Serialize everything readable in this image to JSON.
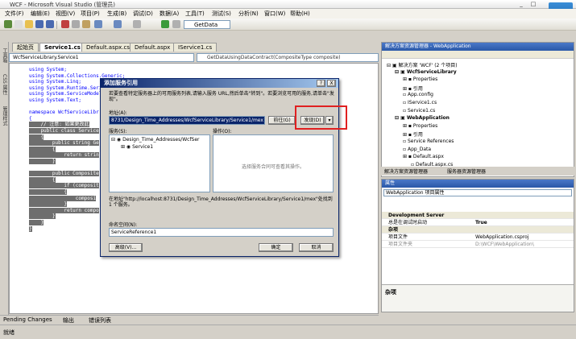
{
  "window": {
    "title": "WCF - Microsoft Visual Studio (管理员)",
    "min": "_",
    "max": "□",
    "close": "X"
  },
  "menu": [
    "文件(F)",
    "编辑(E)",
    "视图(V)",
    "项目(P)",
    "生成(B)",
    "调试(D)",
    "数据(A)",
    "工具(T)",
    "测试(S)",
    "分析(N)",
    "窗口(W)",
    "帮助(H)"
  ],
  "toolbar": {
    "combo_value": "GetData"
  },
  "side_tabs": [
    "工具箱",
    "CSS 属性",
    "管理样式"
  ],
  "doc_tabs": [
    "起始页",
    "Service1.cs",
    "Default.aspx.cs",
    "Default.aspx",
    "IService1.cs"
  ],
  "class_combo": "WcfServiceLibrary.Service1",
  "method_combo": "GetDataUsingDataContract(CompositeType composite)",
  "code_lines": [
    "using System;",
    "using System.Collections.Generic;",
    "using System.Linq;",
    "using System.Runtime.Seri",
    "using System.ServiceModel",
    "using System.Text;",
    "",
    "namespace WcfServiceLibr",
    "{",
    "    // 注意: 如果更改此",
    "    public class Service",
    "    {",
    "        public string Ge",
    "        {",
    "            return strin",
    "        }",
    "",
    "        public Composite",
    "        {",
    "            if (composit",
    "            {",
    "                composi",
    "            }",
    "            return compo",
    "        }",
    "    }",
    "}"
  ],
  "bottom_tabs": [
    "Pending Changes",
    "输出",
    "错误列表"
  ],
  "status": "就绪",
  "solution_explorer": {
    "title": "解决方案资源管理器 - WebApplication",
    "items": [
      "解决方案 'WCF' (2 个项目)",
      "WcfServiceLibrary",
      "Properties",
      "引用",
      "App.config",
      "IService1.cs",
      "Service1.cs",
      "WebApplication",
      "Properties",
      "引用",
      "Service References",
      "App_Data",
      "Default.aspx",
      "Default.aspx.cs",
      "Default.aspx.designer.cs"
    ],
    "tabs": [
      "解决方案资源管理器",
      "服务器资源管理器"
    ]
  },
  "properties": {
    "title": "属性",
    "object": "WebApplication 项目属性",
    "category1": "Development Server",
    "rows1": [
      [
        "总是在调试时启动",
        "True"
      ]
    ],
    "category2": "杂项",
    "rows2": [
      [
        "项目文件",
        "WebApplication.csproj"
      ],
      [
        "项目文件夹",
        "D:\\WCF\\WebApplication\\"
      ]
    ],
    "desc": "杂项"
  },
  "dialog": {
    "title": "添加服务引用",
    "help": "?",
    "close": "X",
    "intro": "若要查看特定服务器上的可用服务列表,请输入服务 URL,然后单击\"转到\"。若要浏览可用的服务,请单击\"发现\"。",
    "address_label": "地址(A):",
    "address_value": "8731/Design_Time_Addresses/WcfServiceLibrary/Service1/mex",
    "go_button": "前往(G)",
    "discover_button": "发现(D)",
    "discover_arrow": "▾",
    "services_label": "服务(S):",
    "operations_label": "操作(O):",
    "service_tree": [
      "Design_Time_Addresses/WcfSer",
      "Service1"
    ],
    "operations_placeholder": "选择服务合同可查看其操作。",
    "found_text": "在地址\"http://localhost:8731/Design_Time_Addresses/WcfServiceLibrary/Service1/mex\"处找到 1 个服务。",
    "namespace_label": "命名空间(N):",
    "namespace_value": "ServiceReference1",
    "advanced_button": "高级(V)...",
    "ok_button": "确定",
    "cancel_button": "取消"
  },
  "colors": {
    "highlight": "#e02020",
    "title_blue": "#0a246a"
  }
}
